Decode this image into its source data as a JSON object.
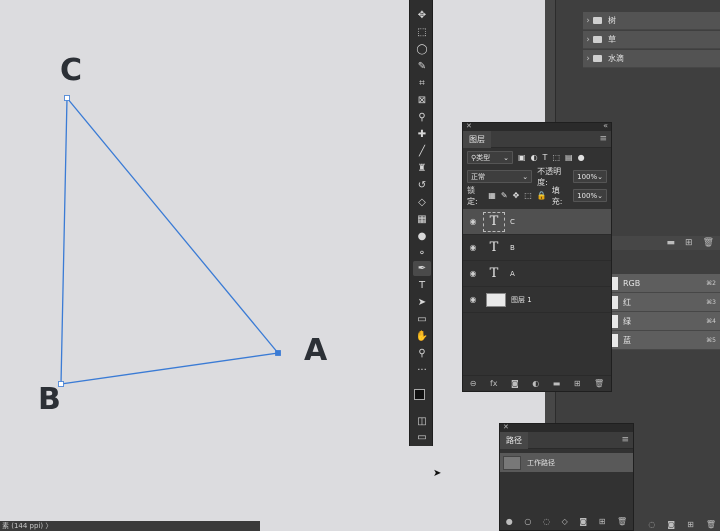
{
  "canvas": {
    "labels": {
      "a": "A",
      "b": "B",
      "c": "C"
    },
    "path_color": "#3a7bd5",
    "background": "#dcdcdf"
  },
  "status_bar": {
    "text": "素 (144 ppi) 〉"
  },
  "toolbar": {
    "tools": [
      "move-icon",
      "marquee-icon",
      "lasso-icon",
      "quick-select-icon",
      "crop-icon",
      "frame-icon",
      "eyedropper-icon",
      "healing-brush-icon",
      "brush-icon",
      "clone-stamp-icon",
      "history-brush-icon",
      "eraser-icon",
      "gradient-icon",
      "blur-icon",
      "dodge-icon",
      "pen-icon",
      "type-icon",
      "path-select-icon",
      "rectangle-icon",
      "hand-icon",
      "zoom-icon",
      "more-tools-icon"
    ]
  },
  "folder_tree": {
    "items": [
      {
        "label": "树"
      },
      {
        "label": "草"
      },
      {
        "label": "水滴"
      }
    ]
  },
  "channels": {
    "items": [
      {
        "label": "RGB",
        "shortcut": "⌘2"
      },
      {
        "label": "红",
        "shortcut": "⌘3"
      },
      {
        "label": "绿",
        "shortcut": "⌘4"
      },
      {
        "label": "蓝",
        "shortcut": "⌘5"
      }
    ]
  },
  "layers_panel": {
    "title": "图层",
    "filter_label": "类型",
    "blend_mode": "正常",
    "opacity_label": "不透明度:",
    "opacity_value": "100%",
    "lock_label": "锁定:",
    "fill_label": "填充:",
    "fill_value": "100%",
    "layers": [
      {
        "name": "C",
        "type": "text",
        "selected": true
      },
      {
        "name": "B",
        "type": "text",
        "selected": false
      },
      {
        "name": "A",
        "type": "text",
        "selected": false
      },
      {
        "name": "图层 1",
        "type": "image",
        "selected": false
      }
    ]
  },
  "paths_panel": {
    "title": "路径",
    "paths": [
      {
        "name": "工作路径"
      }
    ]
  }
}
